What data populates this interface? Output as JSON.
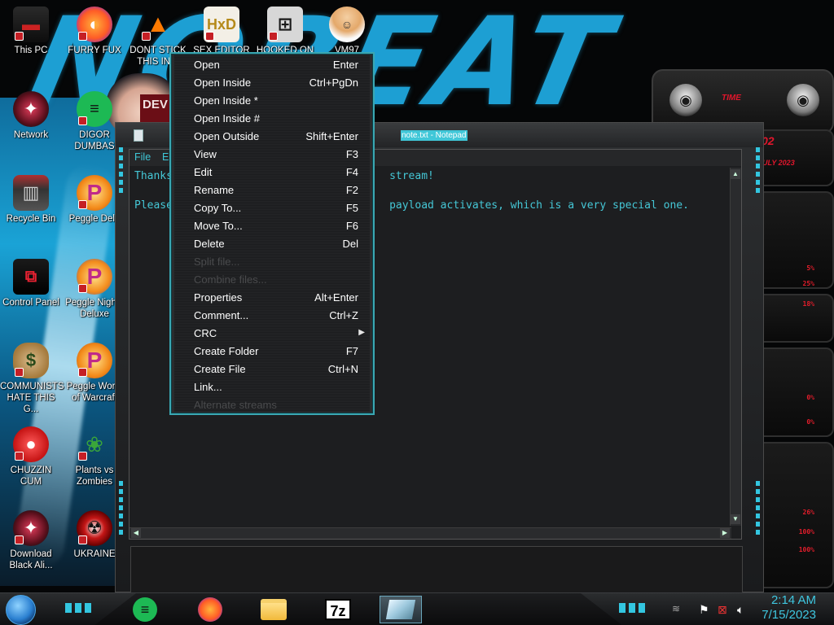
{
  "desktop": {
    "icons": [
      {
        "label": "This PC"
      },
      {
        "label": "FURRY FUX"
      },
      {
        "label": "DONT STICK THIS IN Y"
      },
      {
        "label": "SEX EDITOR"
      },
      {
        "label": "HOOKED ON"
      },
      {
        "label": "VM97"
      },
      {
        "label": "Network"
      },
      {
        "label": "DIGOR DUMBAS"
      },
      {
        "label": "Recycle Bin"
      },
      {
        "label": "Peggle Delu"
      },
      {
        "label": "Control Panel"
      },
      {
        "label": "Peggle Nights Deluxe"
      },
      {
        "label": "COMMUNISTS HATE THIS G..."
      },
      {
        "label": "Peggle World of Warcraft"
      },
      {
        "label": "CHUZZIN CUM"
      },
      {
        "label": "Plants vs Zombies"
      },
      {
        "label": "Download Black Ali..."
      },
      {
        "label": "UKRAINE"
      }
    ],
    "wallpaper_text": "NOBEAT",
    "wallpaper_badge": "DEV"
  },
  "gadget": {
    "title": "TIME",
    "date": "JULY 2023",
    "time_fragment": "02",
    "percents": [
      "5%",
      "25%",
      "18%",
      "0%",
      "0%",
      "26%",
      "100%",
      "100%"
    ]
  },
  "notepad": {
    "title": "note.txt - Notepad",
    "menu": [
      "File",
      "E"
    ],
    "lines": [
      "Thanks                                  stream!",
      "",
      "Please                                  payload activates, which is a very special one."
    ]
  },
  "context_menu": {
    "items": [
      {
        "label": "Open",
        "shortcut": "Enter",
        "disabled": false
      },
      {
        "label": "Open Inside",
        "shortcut": "Ctrl+PgDn",
        "disabled": false
      },
      {
        "label": "Open Inside *",
        "shortcut": "",
        "disabled": false
      },
      {
        "label": "Open Inside #",
        "shortcut": "",
        "disabled": false
      },
      {
        "label": "Open Outside",
        "shortcut": "Shift+Enter",
        "disabled": false
      },
      {
        "label": "View",
        "shortcut": "F3",
        "disabled": false
      },
      {
        "label": "Edit",
        "shortcut": "F4",
        "disabled": false
      },
      {
        "label": "Rename",
        "shortcut": "F2",
        "disabled": false
      },
      {
        "label": "Copy To...",
        "shortcut": "F5",
        "disabled": false
      },
      {
        "label": "Move To...",
        "shortcut": "F6",
        "disabled": false
      },
      {
        "label": "Delete",
        "shortcut": "Del",
        "disabled": false
      },
      {
        "label": "Split file...",
        "shortcut": "",
        "disabled": true
      },
      {
        "label": "Combine files...",
        "shortcut": "",
        "disabled": true
      },
      {
        "label": "Properties",
        "shortcut": "Alt+Enter",
        "disabled": false
      },
      {
        "label": "Comment...",
        "shortcut": "Ctrl+Z",
        "disabled": false
      },
      {
        "label": "CRC",
        "shortcut": "",
        "disabled": false,
        "submenu": true
      },
      {
        "label": "Create Folder",
        "shortcut": "F7",
        "disabled": false
      },
      {
        "label": "Create File",
        "shortcut": "Ctrl+N",
        "disabled": false
      },
      {
        "label": "Link...",
        "shortcut": "",
        "disabled": false
      },
      {
        "label": "Alternate streams",
        "shortcut": "",
        "disabled": true
      }
    ]
  },
  "taskbar": {
    "pinned": [
      "spotify-icon",
      "firefox-icon",
      "file-explorer-icon",
      "7zip-icon",
      "window-app-icon"
    ],
    "seven_zip_label": "7z",
    "clock_time": "2:14 AM",
    "clock_date": "7/15/2023"
  },
  "colors": {
    "accent": "#3fc7d8",
    "menu_border": "#3aa7b2",
    "wallpaper_blue": "#1d9fd3",
    "gadget_red": "#e2162c"
  }
}
